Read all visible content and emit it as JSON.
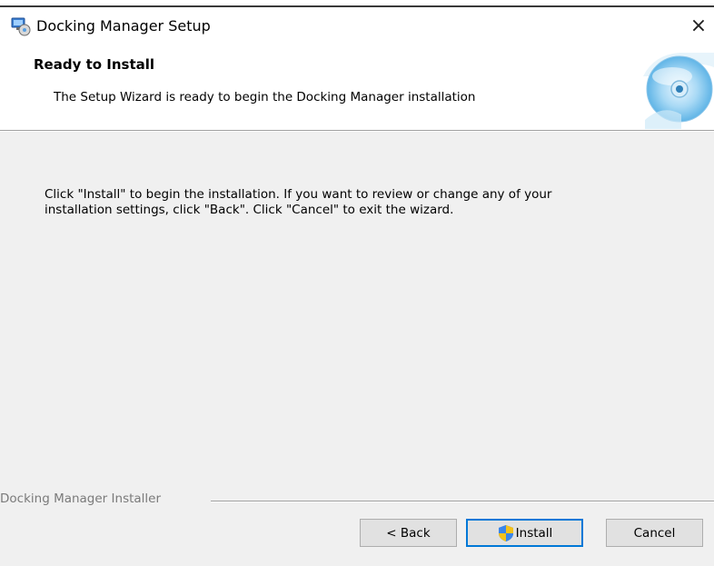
{
  "window": {
    "title": "Docking Manager Setup",
    "close_glyph": "×"
  },
  "banner": {
    "title": "Ready to Install",
    "description": "The Setup Wizard is ready to begin the Docking Manager installation"
  },
  "body": {
    "message_line1": "Click \"Install\" to begin the installation.  If you want to review or change any of your",
    "message_line2": "installation settings, click \"Back\".  Click \"Cancel\" to exit the wizard."
  },
  "footer": {
    "installer_label": "Docking Manager Installer"
  },
  "buttons": {
    "back": "< Back",
    "install": "Install",
    "cancel": "Cancel"
  },
  "icons": {
    "app": "installer-icon",
    "banner": "disc-icon",
    "install": "uac-shield-icon"
  },
  "colors": {
    "accent": "#0078d7",
    "background": "#f0f0f0",
    "banner_bg": "#ffffff"
  }
}
